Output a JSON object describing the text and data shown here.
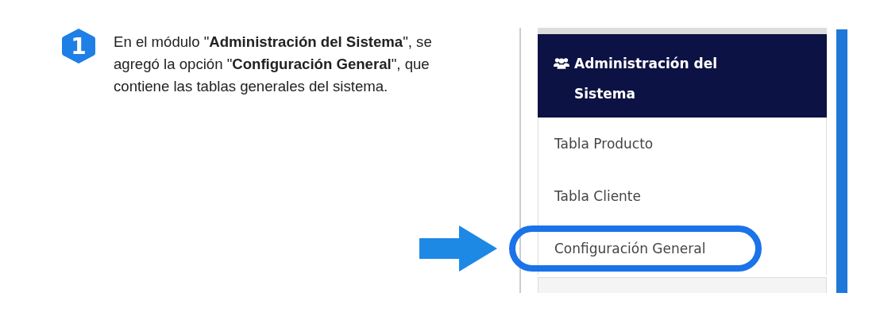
{
  "step": {
    "number": "1",
    "text": "En el módulo \"**Administración del Sistema**\", se agregó la opción \"**Configuración General**\", que contiene las tablas generales del sistema."
  },
  "menu": {
    "header": "Administración del Sistema",
    "items": [
      {
        "label": "Tabla Producto",
        "highlighted": false
      },
      {
        "label": "Tabla Cliente",
        "highlighted": false
      },
      {
        "label": "Configuración General",
        "highlighted": true
      }
    ]
  }
}
